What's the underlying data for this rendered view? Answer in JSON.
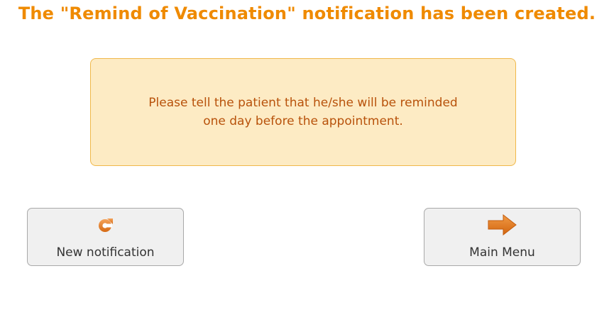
{
  "header": {
    "title": "The \"Remind of Vaccination\" notification has been created."
  },
  "message": {
    "line1": "Please tell the patient that he/she will be reminded",
    "line2": "one day before the appointment."
  },
  "buttons": {
    "new_notification": {
      "label": "New notification",
      "icon": "refresh-icon"
    },
    "main_menu": {
      "label": "Main Menu",
      "icon": "arrow-right-icon"
    }
  },
  "colors": {
    "title": "#ef8a00",
    "message_bg": "#fdebc4",
    "message_border": "#f0b84a",
    "message_text": "#b8520b",
    "icon_orange": "#e8822a",
    "button_bg": "#f0f0f0"
  }
}
